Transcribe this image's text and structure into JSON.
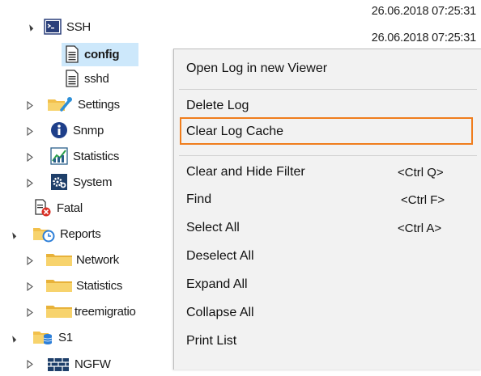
{
  "timestamps": [
    "26.06.2018 07:25:31",
    "26.06.2018 07:25:31"
  ],
  "tree": {
    "items": [
      {
        "label": "SSH",
        "icon": "terminal-icon",
        "expander": "open"
      },
      {
        "label": "config",
        "icon": "document-icon",
        "expander": "none",
        "selected": true
      },
      {
        "label": "sshd",
        "icon": "document-icon",
        "expander": "none"
      },
      {
        "label": "Settings",
        "icon": "folder-wrench-icon",
        "expander": "closed"
      },
      {
        "label": "Snmp",
        "icon": "info-icon",
        "expander": "closed"
      },
      {
        "label": "Statistics",
        "icon": "statistics-icon",
        "expander": "closed"
      },
      {
        "label": "System",
        "icon": "gears-icon",
        "expander": "closed"
      },
      {
        "label": "Fatal",
        "icon": "fatal-document-icon",
        "expander": "none"
      },
      {
        "label": "Reports",
        "icon": "folder-clock-icon",
        "expander": "open"
      },
      {
        "label": "Network",
        "icon": "folder-icon",
        "expander": "closed"
      },
      {
        "label": "Statistics",
        "icon": "folder-icon",
        "expander": "closed"
      },
      {
        "label": "treemigratio",
        "icon": "folder-icon",
        "expander": "closed"
      },
      {
        "label": "S1",
        "icon": "folder-database-icon",
        "expander": "open"
      },
      {
        "label": "NGFW",
        "icon": "firewall-icon",
        "expander": "closed"
      }
    ]
  },
  "context_menu": {
    "items": [
      {
        "label": "Open Log in new Viewer",
        "shortcut": ""
      },
      {
        "label": "Delete Log",
        "shortcut": ""
      },
      {
        "label": "Clear Log Cache",
        "shortcut": "",
        "highlighted": true
      },
      {
        "label": "Clear and Hide Filter",
        "shortcut": "<Ctrl Q>"
      },
      {
        "label": "Find",
        "shortcut": "<Ctrl F>"
      },
      {
        "label": "Select All",
        "shortcut": "<Ctrl A>"
      },
      {
        "label": "Deselect All",
        "shortcut": ""
      },
      {
        "label": "Expand All",
        "shortcut": ""
      },
      {
        "label": "Collapse All",
        "shortcut": ""
      },
      {
        "label": "Print List",
        "shortcut": ""
      }
    ]
  },
  "colors": {
    "selection": "#cde8fb",
    "highlight_border": "#f07d1c",
    "menu_background": "#f2f2f2",
    "folder": "#f2c04b"
  }
}
